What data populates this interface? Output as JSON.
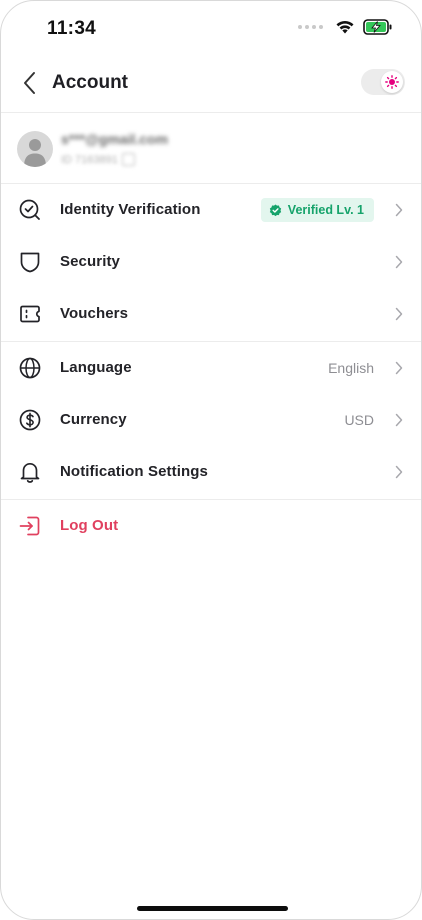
{
  "status_bar": {
    "time": "11:34",
    "icons": [
      "signal-dots-icon",
      "wifi-icon",
      "battery-charging-icon"
    ],
    "battery_color": "#34c759"
  },
  "header": {
    "title": "Account",
    "back_icon": "chevron-left-icon",
    "toggle_icon": "sun-icon",
    "accent": "#e6007e"
  },
  "profile": {
    "email": "s***@gmail.com",
    "id": "ID 7163891"
  },
  "menu": {
    "identity": {
      "label": "Identity Verification",
      "badge": "Verified Lv. 1",
      "icon": "identity-check-icon"
    },
    "security": {
      "label": "Security",
      "icon": "shield-icon"
    },
    "vouchers": {
      "label": "Vouchers",
      "icon": "ticket-icon"
    },
    "language": {
      "label": "Language",
      "value": "English",
      "icon": "globe-icon"
    },
    "currency": {
      "label": "Currency",
      "value": "USD",
      "icon": "dollar-icon"
    },
    "notifications": {
      "label": "Notification Settings",
      "icon": "bell-icon"
    },
    "logout": {
      "label": "Log Out",
      "icon": "logout-icon"
    }
  },
  "colors": {
    "verified_text": "#16a36b",
    "verified_bg": "#e3f6ee",
    "logout": "#e0405f"
  }
}
